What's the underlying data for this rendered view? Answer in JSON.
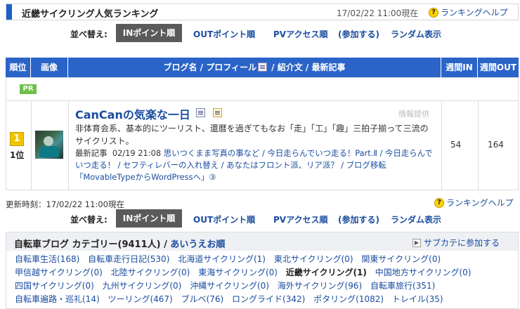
{
  "header": {
    "title": "近畿サイクリング人気ランキング",
    "timestamp": "17/02/22 11:00現在",
    "help": "ランキングヘルプ"
  },
  "sort": {
    "label": "並べ替え:",
    "active": "INポイント順",
    "options": [
      "OUTポイント順",
      "PVアクセス順",
      "(参加する)",
      "ランダム表示"
    ]
  },
  "table": {
    "columns": {
      "rank": "順位",
      "image": "画像",
      "blog": "ブログ名 / プロフィール",
      "blog_rest": " / 紹介文 / 最新記事",
      "in": "週間IN",
      "out": "週間OUT"
    },
    "pr": "PR",
    "row": {
      "rank_badge": "1",
      "rank": "1位",
      "title": "CanCanの気楽な一日",
      "info": "情報提供",
      "description": "非体育会系、基本的にツーリスト、還暦を過ぎてもなお「走」「工」「趣」三拍子揃って三流のサイクリスト。",
      "recent_label": "最新記事",
      "recent_date": "02/19 21:08",
      "recent_posts": "思いつくまま写真の事など / 今日走らんでいつ走る！Part.Ⅱ / 今日走らんでいつ走る！ / セフティレバーの入れ替え / あなたはフロント派、リア派？ / ブログ移転「MovableTypeからWordPressへ」③",
      "in": "54",
      "out": "164"
    }
  },
  "updated": "更新時刻：17/02/22 11:00現在",
  "category": {
    "title": "自転車ブログ カテゴリー(9411人) / ",
    "aiueo": "あいうえお順",
    "subcat": "サブカテに参加する",
    "items": [
      "自転車生活(168)",
      "自転車走行日記(530)",
      "北海道サイクリング(1)",
      "東北サイクリング(0)",
      "関東サイクリング(0)",
      "甲信越サイクリング(0)",
      "北陸サイクリング(0)",
      "東海サイクリング(0)",
      "近畿サイクリング(1)",
      "中国地方サイクリング(0)",
      "四国サイクリング(0)",
      "九州サイクリング(0)",
      "沖縄サイクリング(0)",
      "海外サイクリング(96)",
      "自転車旅行(351)",
      "自転車遍路・巡礼(14)",
      "ツーリング(467)",
      "ブルベ(76)",
      "ロングライド(342)",
      "ポタリング(1082)",
      "トレイル(35)"
    ],
    "current": "近畿サイクリング(1)"
  }
}
